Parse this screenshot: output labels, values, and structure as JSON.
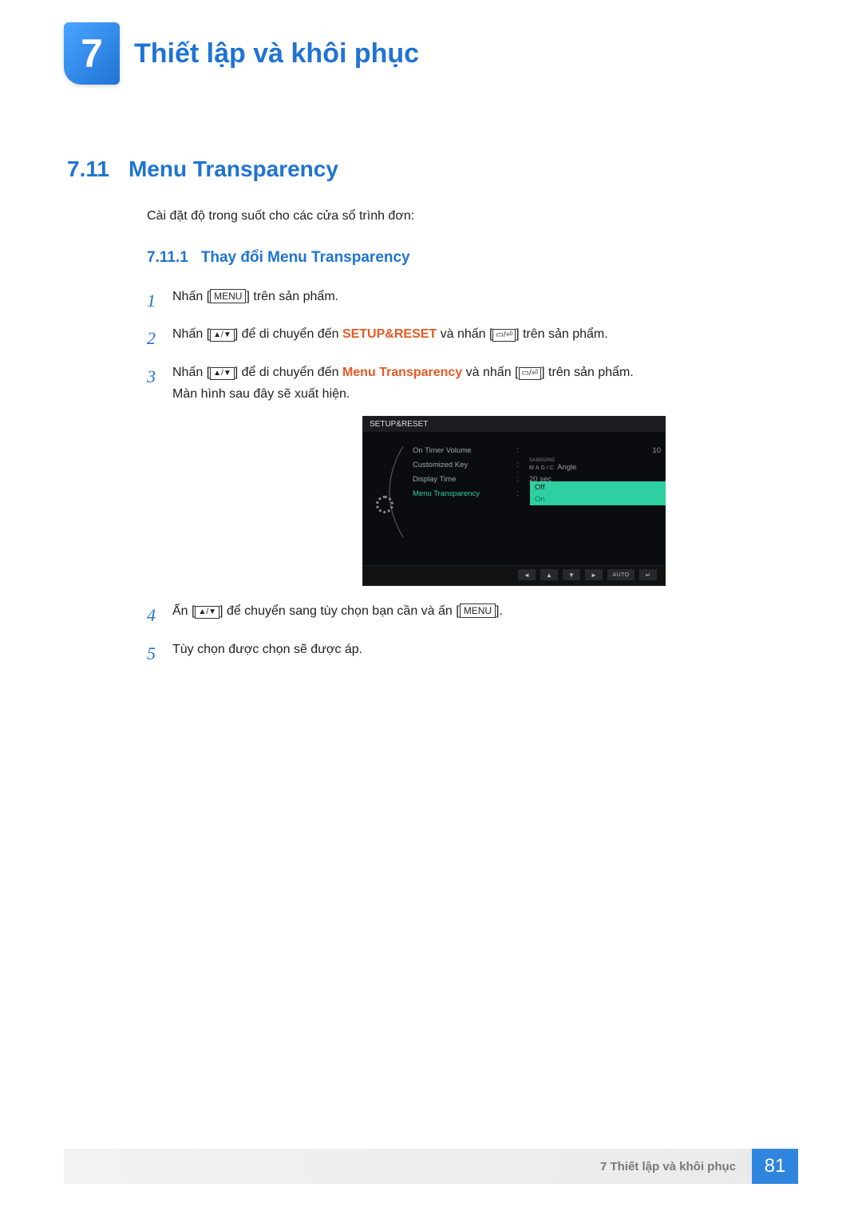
{
  "chapter": {
    "number": "7",
    "title": "Thiết lập và khôi phục"
  },
  "section": {
    "number": "7.11",
    "title": "Menu Transparency"
  },
  "intro": "Cài đặt độ trong suốt cho các cửa sổ trình đơn:",
  "subsection": {
    "number": "7.11.1",
    "title": "Thay đổi Menu Transparency"
  },
  "labels": {
    "menu": "MENU"
  },
  "steps": {
    "s1_a": "Nhấn [",
    "s1_b": "] trên sản phẩm.",
    "s2_a": "Nhấn [",
    "s2_b": "] để di chuyển đến ",
    "s2_hl": "SETUP&RESET",
    "s2_c": " và nhấn [",
    "s2_d": "] trên sản phẩm.",
    "s3_a": "Nhấn [",
    "s3_b": "] để di chuyển đến ",
    "s3_hl": "Menu Transparency",
    "s3_c": " và nhấn [",
    "s3_d": "] trên sản phẩm.",
    "s3_sub": "Màn hình sau đây sẽ xuất hiện.",
    "s4_a": "Ấn [",
    "s4_b": "] để chuyển sang tùy chọn bạn cần và ấn [",
    "s4_c": "].",
    "s5": "Tùy chọn được chọn sẽ được áp."
  },
  "osd": {
    "title": "SETUP&RESET",
    "rows": [
      {
        "label": "On Timer Volume",
        "value": "10",
        "right": true
      },
      {
        "label": "Customized Key",
        "samsung": "SAMSUNG",
        "magic": "MAGIC",
        "angle": " Angle"
      },
      {
        "label": "Display Time",
        "value": "20 sec"
      },
      {
        "label": "Menu Transparency",
        "active": true
      }
    ],
    "options": {
      "off": "Off",
      "on": "On"
    },
    "buttons": {
      "auto": "AUTO"
    }
  },
  "footer": {
    "text": "7 Thiết lập và khôi phục",
    "page": "81"
  }
}
